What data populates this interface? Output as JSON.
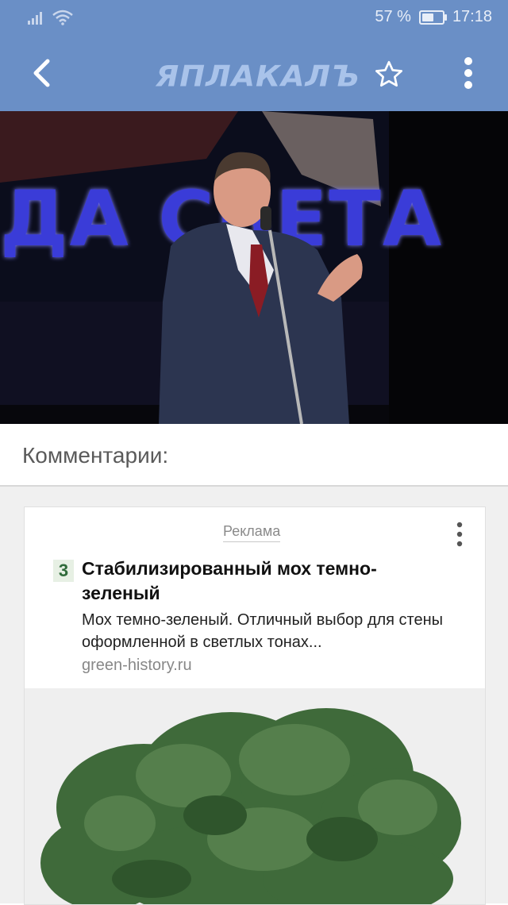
{
  "status_bar": {
    "battery_percent": "57 %",
    "battery_level": 0.57,
    "time": "17:18"
  },
  "app_bar": {
    "logo_text": "ЯПЛАКАЛЪ",
    "accent_color": "#6a8fc6"
  },
  "photo": {
    "screen_text": "ДА СВЕТА"
  },
  "comments": {
    "title": "Комментарии:"
  },
  "ad": {
    "label": "Реклама",
    "favicon_letter": "3",
    "title": "Стабилизированный мох темно-зеленый",
    "description": "Мох темно-зеленый. Отличный выбор для стены оформленной в светлых тонах...",
    "domain": "green-history.ru"
  },
  "icons": {
    "signal": "signal-icon",
    "wifi": "wifi-icon",
    "battery": "battery-icon",
    "back": "back-arrow-icon",
    "star": "star-icon",
    "more": "more-vertical-icon"
  }
}
